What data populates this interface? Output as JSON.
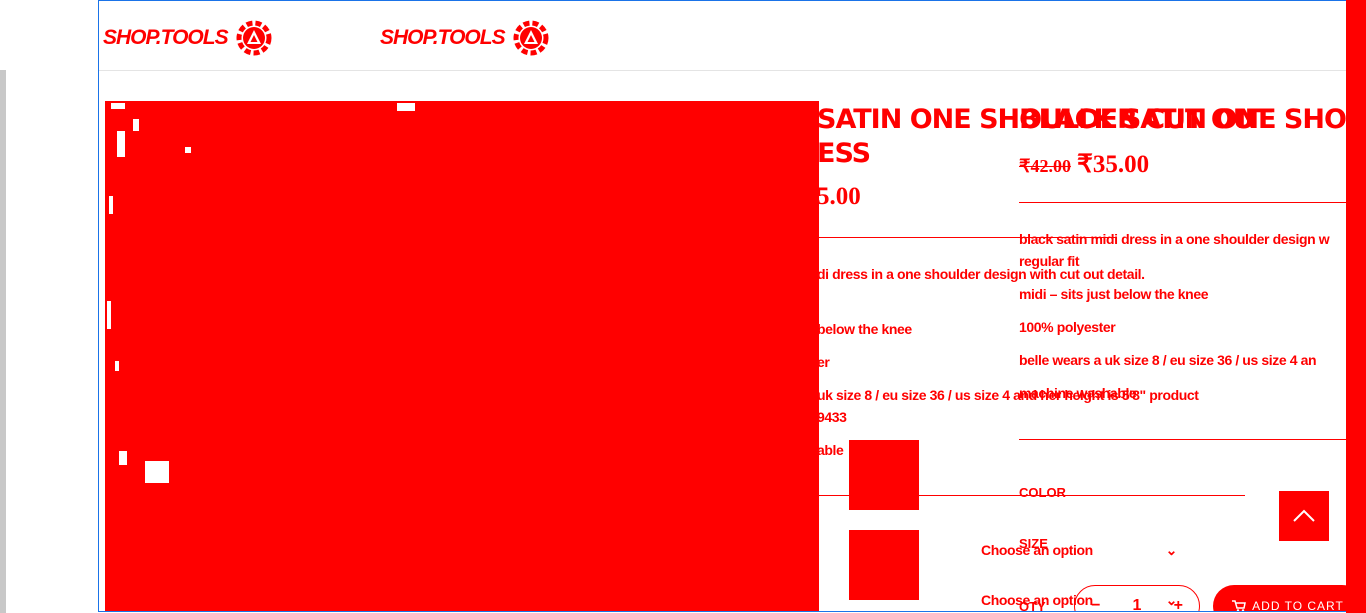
{
  "header": {
    "logo_text": "SHOP.TOOLS",
    "logo_text_2": "SHOP.TOOLS",
    "logo_icon": "gear-triangle-icon"
  },
  "product_image": {
    "alt": "product-photo"
  },
  "product_back": {
    "title_line1": "SATIN ONE SHOULDER CUT OUT",
    "title_line2": "ESS",
    "price_fragment": "5.00",
    "desc1": "di dress in a one shoulder design with cut out detail.",
    "desc2": "below the knee",
    "desc3": "er",
    "desc4": "uk size 8 / eu size 36 / us size 4 and her height is 5'8\" product",
    "desc5": "9433",
    "desc6": "able"
  },
  "product": {
    "title": "BLACK SATIN ONE SHOULDER",
    "old_price": "₹42.00",
    "new_price": "₹35.00",
    "desc": [
      "black satin midi dress in a one shoulder design w",
      "regular fit",
      "midi – sits just below the knee",
      "100% polyester",
      "belle wears a uk size 8 / eu size 36 / us size 4 an",
      "machine washable"
    ],
    "color_label": "COLOR",
    "size_label": "SIZE",
    "select_placeholder_1": "Choose an option",
    "select_placeholder_2": "Choose an option",
    "qty_label": "QTY",
    "qty_value": "1",
    "qty_minus": "−",
    "qty_plus": "+",
    "add_to_cart": "ADD TO CART"
  },
  "colors": {
    "accent": "#ff0000",
    "frame_border": "#1a73e8"
  }
}
